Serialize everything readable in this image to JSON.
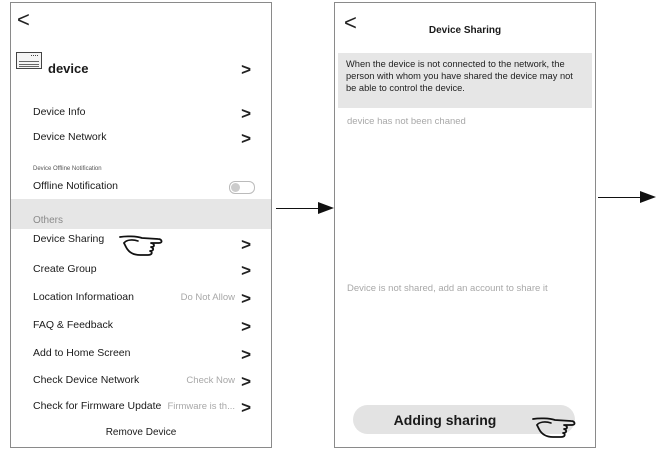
{
  "left_screen": {
    "back_glyph": "<",
    "device_title": "device",
    "rows": [
      {
        "label": "Device Info",
        "value": ""
      },
      {
        "label": "Device Network",
        "value": ""
      }
    ],
    "offline_caption": "Device Offline Notification",
    "offline_label": "Offline Notification",
    "offline_toggle_on": false,
    "others_header": "Others",
    "other_rows": [
      {
        "label": "Device Sharing",
        "value": ""
      },
      {
        "label": "Create Group",
        "value": ""
      },
      {
        "label": "Location Informatioan",
        "value": "Do Not Allow"
      },
      {
        "label": "FAQ & Feedback",
        "value": ""
      },
      {
        "label": "Add to Home Screen",
        "value": ""
      },
      {
        "label": "Check Device Network",
        "value": "Check Now"
      },
      {
        "label": "Check for Firmware Update",
        "value": "Firmware is th..."
      }
    ],
    "remove_label": "Remove Device",
    "chevron": ">"
  },
  "right_screen": {
    "back_glyph": "<",
    "title": "Device Sharing",
    "notice": "When the device is not connected to the network, the person with whom you have shared the device may not be able to control the device.",
    "status_text": "device has not been chaned",
    "empty_text": "Device is not shared, add an account to share it",
    "add_button_label": "Adding sharing"
  },
  "colors": {
    "band": "#e6e6e6",
    "muted_text": "#a8a8a8",
    "frame": "#8a8a8a"
  },
  "icons": [
    "back-arrow-icon",
    "chevron-right-icon",
    "ac-unit-icon",
    "pointing-hand-icon",
    "flow-arrow-icon"
  ]
}
